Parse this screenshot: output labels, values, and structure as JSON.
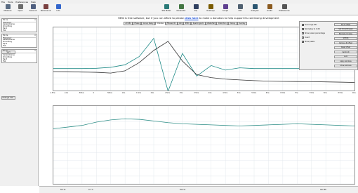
{
  "menu": [
    "File",
    "Tools",
    "Preferences",
    "Help"
  ],
  "toolbar": [
    {
      "label": "Measure",
      "color": "#5a6b82"
    },
    {
      "label": "Open",
      "color": "#6b6b6b"
    },
    {
      "label": "Save All",
      "color": "#506080"
    },
    {
      "label": "Remove All",
      "color": "#7a4040"
    },
    {
      "label": "Info",
      "color": "#3366cc"
    },
    {
      "label": "SPL Meter",
      "color": "#2b7a78"
    },
    {
      "label": "Generator",
      "color": "#447744"
    },
    {
      "label": "EQ",
      "color": "#304060"
    },
    {
      "label": "Overlays",
      "color": "#7a5b00"
    },
    {
      "label": "Scope",
      "color": "#604090"
    },
    {
      "label": "RTA",
      "color": "#506070"
    },
    {
      "label": "Analyser",
      "color": "#2a5570"
    },
    {
      "label": "Limits",
      "color": "#8a5a20"
    },
    {
      "label": "Preferences",
      "color": "#555555"
    }
  ],
  "banner": {
    "prefix": "REW is free software, but if you can afford to please ",
    "link": "click here",
    "suffix": " to make a donation to help support its continuing development"
  },
  "tabs": [
    "All SPL",
    "Phase",
    "Group Delay",
    "Impulse",
    "Filtered IR",
    "GD",
    "RT60",
    "Spectrogram",
    "Waterfall",
    "Distortion",
    "Decay",
    "Overlay"
  ],
  "active_tab": "Impulse",
  "measurements": [
    {
      "title": "Fat 1a",
      "line1": "Frequency",
      "line2": "Generate sine",
      "line3": "Smoothing",
      "line4": "Tap 1",
      "line5": "Flat"
    },
    {
      "title": "Fat 2a",
      "line1": "Frequency",
      "line2": "Generate sine",
      "line3": "Smoothing",
      "line4": "Tap 2",
      "line5": "Flat"
    },
    {
      "title": "Fat 3a",
      "line1": "Frequency",
      "line2": "Generate sine",
      "line3": "Smoothing",
      "line4": "Tap 3",
      "line5": "Flat"
    }
  ],
  "left_buttons": {
    "sort": "Sort",
    "change": "Change Cal..."
  },
  "panel": {
    "checks": [
      {
        "label": "Sub-range SPL",
        "on": true
      },
      {
        "label": "Normalise to 0 dB",
        "on": false
      },
      {
        "label": "Show power percentage",
        "on": false
      },
      {
        "label": "Invert",
        "on": false
      },
      {
        "label": "Show peaks",
        "on": true
      }
    ],
    "buttons": [
      "Set IR offset",
      "Set t=0 at IR peak",
      "Estimate IR delay",
      "Shift IR",
      "Remove IR offset",
      "Reset offset",
      "Centre IR",
      "Auto",
      "Apply windows",
      "Show windows"
    ]
  },
  "xaxis": {
    "ticks": [
      "-1.5ms",
      "-1ms",
      "-500us",
      "0",
      "500us",
      "1ms",
      "1.5ms",
      "2ms",
      "2.5ms",
      "3ms",
      "3.5ms",
      "4ms",
      "4.5ms",
      "5ms",
      "5.5ms",
      "6ms",
      "6.5ms",
      "7ms",
      "7.5ms",
      "8ms",
      "8.5ms",
      "9ms"
    ]
  },
  "status": {
    "left": "Fat 1a",
    "mid1": "0.1 %",
    "mid2": "Flat 1a",
    "right": "Gen 88"
  },
  "chart_data": [
    {
      "type": "line",
      "series": [
        {
          "values": [
            0,
            0,
            0,
            0.2,
            0.8,
            2.5,
            8,
            20,
            -15,
            10,
            -5,
            2,
            -1,
            0.5,
            0,
            0,
            0,
            0,
            0,
            0,
            0,
            0
          ]
        },
        {
          "values": [
            -2,
            -2.1,
            -2.3,
            -2.5,
            -3,
            -1.5,
            4,
            12,
            18,
            5,
            -4,
            -6,
            -7,
            -7.5,
            -8,
            -8.3,
            -8.5,
            -8.6,
            -8.7,
            -8.8,
            -9,
            -9.2
          ]
        }
      ]
    },
    {
      "type": "line",
      "series": [
        {
          "values": [
            0,
            0.3,
            0.6,
            1.2,
            1.6,
            1.8,
            1.7,
            1.4,
            1.1,
            0.9,
            0.8,
            0.7,
            0.6,
            0.5,
            0.6,
            0.7,
            0.8,
            0.9,
            0.8,
            0.7,
            0.6,
            0.5
          ]
        }
      ]
    }
  ]
}
